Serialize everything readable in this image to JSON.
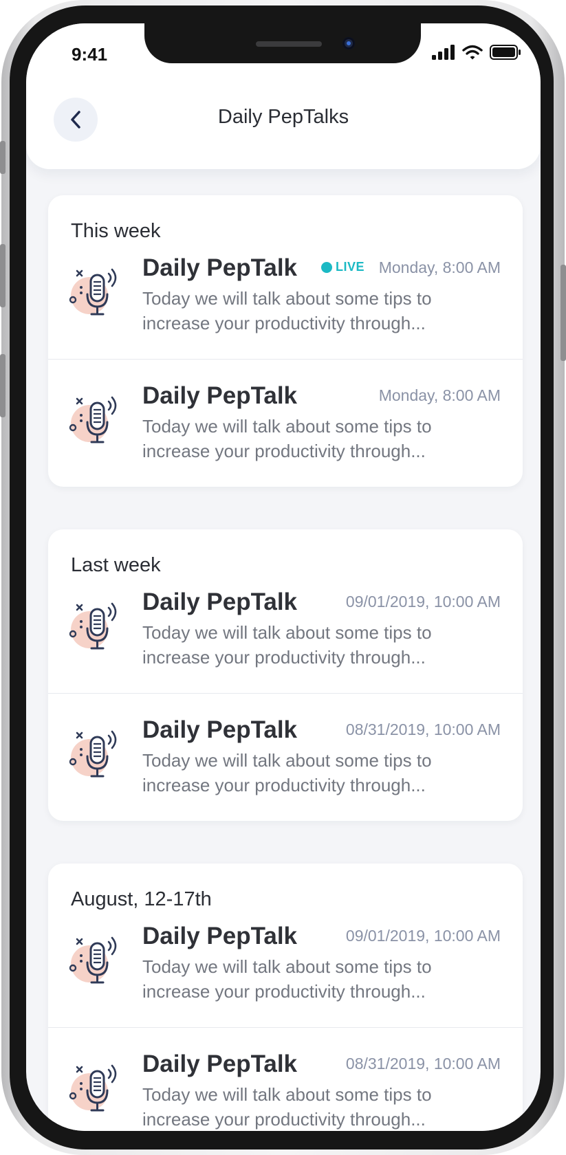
{
  "status_bar": {
    "time": "9:41"
  },
  "header": {
    "title": "Daily PepTalks"
  },
  "sections": [
    {
      "title": "This week",
      "items": [
        {
          "title": "Daily PepTalk",
          "live": "LIVE",
          "date": "Monday, 8:00 AM",
          "description": "Today we will talk about some tips to increase your productivity through..."
        },
        {
          "title": "Daily PepTalk",
          "date": "Monday, 8:00 AM",
          "description": "Today we will talk about some tips to increase your productivity through..."
        }
      ]
    },
    {
      "title": "Last week",
      "items": [
        {
          "title": "Daily PepTalk",
          "date": "09/01/2019, 10:00 AM",
          "description": "Today we will talk about some tips to increase your productivity through..."
        },
        {
          "title": "Daily PepTalk",
          "date": "08/31/2019, 10:00 AM",
          "description": "Today we will talk about some tips to increase your productivity through..."
        }
      ]
    },
    {
      "title": "August, 12-17th",
      "items": [
        {
          "title": "Daily PepTalk",
          "date": "09/01/2019, 10:00 AM",
          "description": "Today we will talk about some tips to increase your productivity through..."
        },
        {
          "title": "Daily PepTalk",
          "date": "08/31/2019, 10:00 AM",
          "description": "Today we will talk about some tips to increase your productivity through..."
        }
      ]
    }
  ],
  "icons": {
    "back": "chevron-left-icon",
    "item": "microphone-icon",
    "signal": "cellular-signal-icon",
    "wifi": "wifi-icon",
    "battery": "battery-icon"
  },
  "colors": {
    "live_accent": "#1bb9c4",
    "mic_blob": "#f6d2c8",
    "mic_stroke": "#2f3a57"
  }
}
